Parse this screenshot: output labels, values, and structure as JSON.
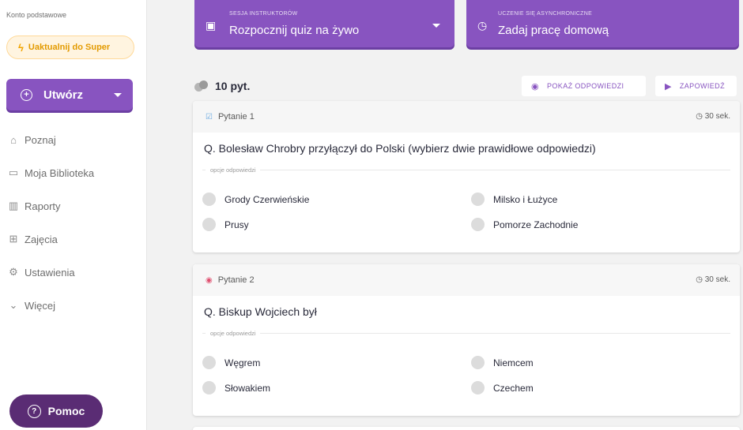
{
  "sidebar": {
    "account_type": "Konto podstawowe",
    "upgrade_label": "Uaktualnij do Super",
    "create_label": "Utwórz",
    "items": [
      {
        "label": "Poznaj",
        "icon": "explore-icon"
      },
      {
        "label": "Moja Biblioteka",
        "icon": "folder-icon"
      },
      {
        "label": "Raporty",
        "icon": "reports-icon"
      },
      {
        "label": "Zajęcia",
        "icon": "classes-icon"
      },
      {
        "label": "Ustawienia",
        "icon": "settings-icon"
      },
      {
        "label": "Więcej",
        "icon": "chevron-down-icon"
      }
    ],
    "help_label": "Pomoc"
  },
  "top": {
    "live": {
      "small": "SESJA INSTRUKTORÓW",
      "big": "Rozpocznij quiz na żywo"
    },
    "homework": {
      "small": "UCZENIE SIĘ ASYNCHRONICZNE",
      "big": "Zadaj pracę domową"
    }
  },
  "quiz": {
    "count": "10 pyt.",
    "show_answers": "POKAŻ ODPOWIEDZI",
    "preview": "ZAPOWIEDŹ"
  },
  "questions": [
    {
      "label": "Pytanie 1",
      "type_icon": "checkbox-icon",
      "time": "30 sek.",
      "text": "Q. Bolesław Chrobry przyłączył do Polski (wybierz dwie prawidłowe odpowiedzi)",
      "options_label": "opcje odpowiedzi",
      "options": [
        "Grody Czerwieńskie",
        "Milsko i Łużyce",
        "Prusy",
        "Pomorze Zachodnie"
      ]
    },
    {
      "label": "Pytanie 2",
      "type_icon": "radio-icon",
      "time": "30 sek.",
      "text": "Q. Biskup Wojciech był",
      "options_label": "opcje odpowiedzi",
      "options": [
        "Węgrem",
        "Niemcem",
        "Słowakiem",
        "Czechem"
      ]
    }
  ],
  "colors": {
    "primary": "#8854c0",
    "help": "#5a2c74",
    "upgrade": "#e39a00"
  }
}
